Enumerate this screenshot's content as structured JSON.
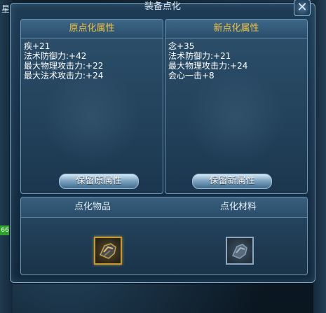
{
  "dialog": {
    "title": "装备点化",
    "close_icon": "close-icon"
  },
  "original_panel": {
    "header": "原点化属性",
    "attributes": [
      "疾+21",
      "法术防御力:+42",
      "最大物理攻击力:+22",
      "最大法术攻击力:+24"
    ],
    "keep_button": "保留原属性"
  },
  "new_panel": {
    "header": "新点化属性",
    "attributes": [
      "念+35",
      "法术防御力:+21",
      "最大物理攻击力:+24",
      "会心一击+8"
    ],
    "keep_button": "保留新属性"
  },
  "bottom": {
    "item_label": "点化物品",
    "material_label": "点化材料",
    "item_icon": "gauntlet-icon",
    "material_icon": "material-icon"
  },
  "background": {
    "left_char": "星",
    "green_badge": "66"
  },
  "colors": {
    "header_text": "#f1c23a",
    "attribute_text": "#ffffff",
    "dialog_bg": "#173149"
  }
}
